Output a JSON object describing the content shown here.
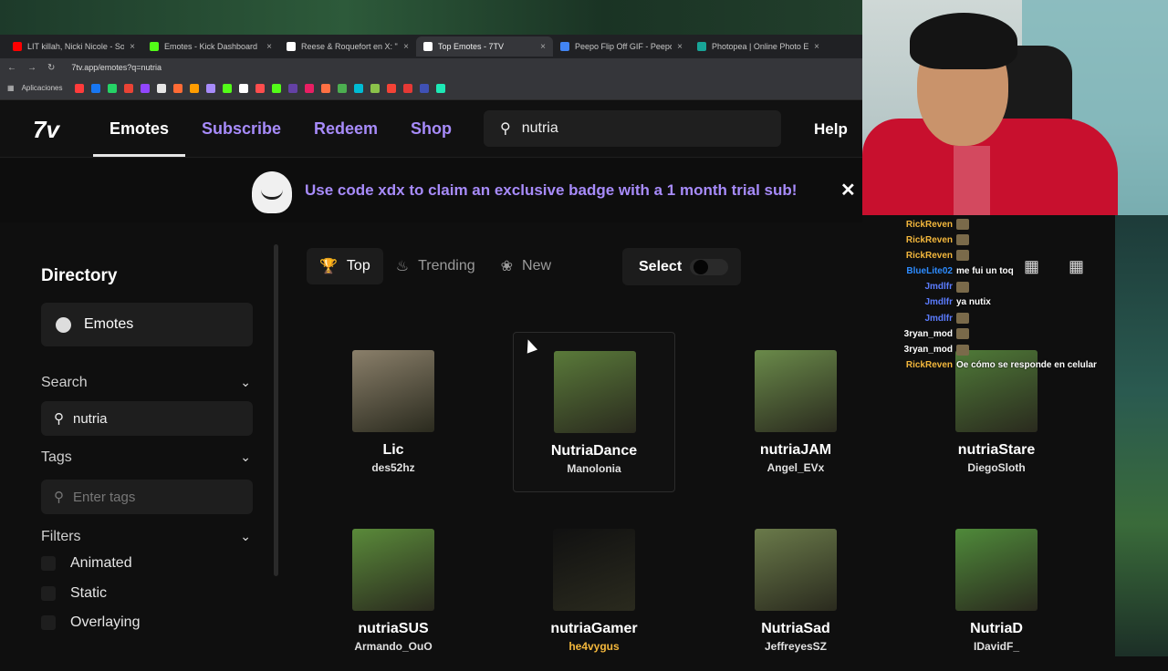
{
  "browser": {
    "tabs": [
      {
        "label": "LIT killah, Nicki Nicole - So",
        "color": "#ff0000"
      },
      {
        "label": "Emotes - Kick Dashboard",
        "color": "#53fc18"
      },
      {
        "label": "Reese & Roquefort en X: \"Tier",
        "color": "#ffffff"
      },
      {
        "label": "Top Emotes - 7TV",
        "color": "#ffffff"
      },
      {
        "label": "Peepo Flip Off GIF - Peepo Flip",
        "color": "#4285f4"
      },
      {
        "label": "Photopea | Online Photo Editor",
        "color": "#18a497"
      }
    ],
    "url": "7tv.app/emotes?q=nutria",
    "apps_label": "Aplicaciones"
  },
  "nav": {
    "logo": "7v",
    "links": {
      "emotes": "Emotes",
      "subscribe": "Subscribe",
      "redeem": "Redeem",
      "shop": "Shop"
    },
    "search_value": "nutria",
    "help": "Help"
  },
  "banner": {
    "message": "Use code xdx to claim an exclusive badge with a 1 month trial sub!",
    "close": "✕"
  },
  "sidebar": {
    "title": "Directory",
    "emotes_item": "Emotes",
    "search_label": "Search",
    "search_value": "nutria",
    "tags_label": "Tags",
    "tags_placeholder": "Enter tags",
    "filters_label": "Filters",
    "checkboxes": [
      "Animated",
      "Static",
      "Overlaying"
    ]
  },
  "toolbar": {
    "top": "Top",
    "trending": "Trending",
    "new": "New",
    "select": "Select"
  },
  "emotes": [
    {
      "name": "Lic",
      "author": "des52hz",
      "color": "#8a7f6a",
      "author_color": "#e0e0e0"
    },
    {
      "name": "NutriaDance",
      "author": "Manolonia",
      "color": "#5a7a3a",
      "author_color": "#e0e0e0"
    },
    {
      "name": "nutriaJAM",
      "author": "Angel_EVx",
      "color": "#6a8a4a",
      "author_color": "#e0e0e0"
    },
    {
      "name": "nutriaStare",
      "author": "DiegoSloth",
      "color": "#4f7a38",
      "author_color": "#e0e0e0"
    },
    {
      "name": "nutriaSUS",
      "author": "Armando_OuO",
      "color": "#5a8a3a",
      "author_color": "#e0e0e0"
    },
    {
      "name": "nutriaGamer",
      "author": "he4vygus",
      "color": "#111111",
      "author_color": "#f3b73c"
    },
    {
      "name": "NutriaSad",
      "author": "JeffreyesSZ",
      "color": "#6a7a4a",
      "author_color": "#e0e0e0"
    },
    {
      "name": "NutriaD",
      "author": "IDavidF_",
      "color": "#4f8a3a",
      "author_color": "#e0e0e0"
    }
  ],
  "chat": [
    {
      "user": "RickReven",
      "text": "",
      "color": "#f3b73c",
      "emote": true
    },
    {
      "user": "RickReven",
      "text": "",
      "color": "#f3b73c",
      "emote": true
    },
    {
      "user": "RickReven",
      "text": "",
      "color": "#f3b73c",
      "emote": true
    },
    {
      "user": "BlueLite02",
      "text": "me fui un toq",
      "color": "#2d8cff",
      "emote": false
    },
    {
      "user": "Jmdlfr",
      "text": "",
      "color": "#5b7cff",
      "emote": true
    },
    {
      "user": "Jmdlfr",
      "text": "ya nutix",
      "color": "#5b7cff",
      "emote": false
    },
    {
      "user": "Jmdlfr",
      "text": "",
      "color": "#5b7cff",
      "emote": true
    },
    {
      "user": "3ryan_mod",
      "text": "",
      "color": "#ffffff",
      "emote": true
    },
    {
      "user": "3ryan_mod",
      "text": "",
      "color": "#ffffff",
      "emote": true
    },
    {
      "user": "RickReven",
      "text": "Oe cómo se responde en celular",
      "color": "#f3b73c",
      "emote": false
    }
  ]
}
